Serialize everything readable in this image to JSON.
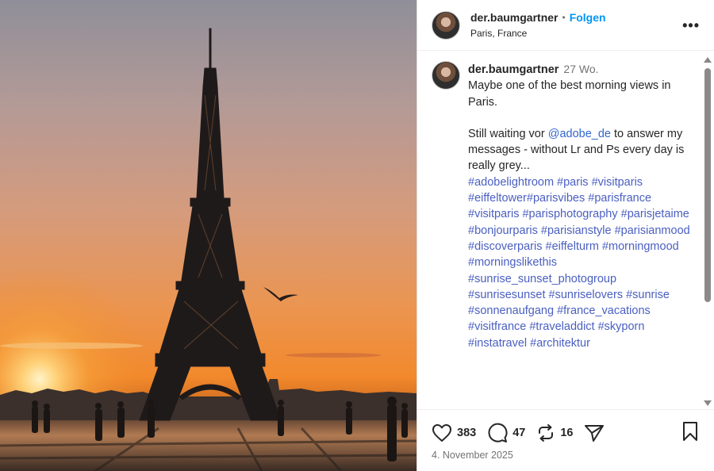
{
  "post": {
    "username": "der.baumgartner",
    "follow_label": "Folgen",
    "separator": "•",
    "location": "Paris, France",
    "more_label": "•••"
  },
  "caption": {
    "username": "der.baumgartner",
    "time": "27 Wo.",
    "line1": "Maybe one of the best morning views in Paris.",
    "line2_pre": "Still waiting vor ",
    "mention": "@adobe_de",
    "line2_post": " to answer my messages - without Lr and Ps every day is really grey...",
    "hashtags": "#adobelightroom #paris #visitparis #eiffeltower#parisvibes #parisfrance #visitparis #parisphotography #parisjetaime #bonjourparis #parisianstyle #parisianmood #discoverparis #eiffelturm #morningmood #morningslikethis #sunrise_sunset_photogroup #sunrisesunset #sunriselovers #sunrise #sonnenaufgang  #france_vacations #visitfrance #traveladdict #skyporn #instatravel #architektur"
  },
  "actions": {
    "likes": "383",
    "comments": "47",
    "reposts": "16",
    "date": "4. November 2025"
  },
  "icons": {
    "like": "heart-icon",
    "comment": "comment-bubble-icon",
    "repost": "repost-icon",
    "share": "send-icon",
    "save": "bookmark-icon"
  }
}
